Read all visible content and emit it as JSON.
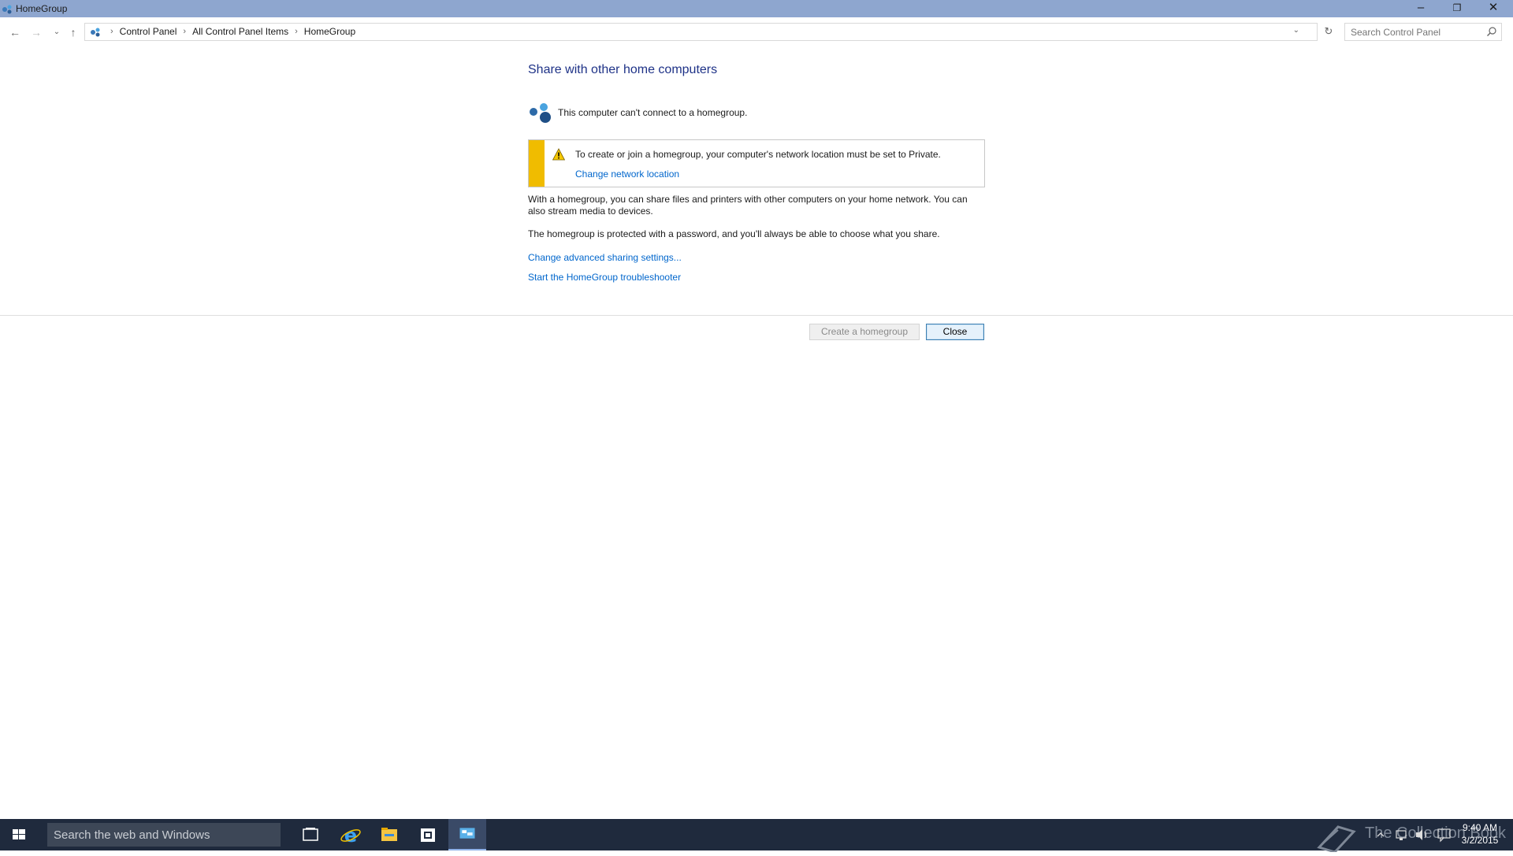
{
  "window": {
    "title": "HomeGroup",
    "controls": [
      "minimize",
      "restore",
      "close"
    ]
  },
  "nav": {
    "back_icon": "back-arrow-icon",
    "forward_icon": "forward-arrow-icon",
    "recent_icon": "chevron-down-icon",
    "up_icon": "up-arrow-icon"
  },
  "address": {
    "breadcrumbs": [
      "Control Panel",
      "All Control Panel Items",
      "HomeGroup"
    ]
  },
  "search": {
    "placeholder": "Search Control Panel"
  },
  "main": {
    "heading": "Share with other home computers",
    "status": "This computer can't connect to a homegroup.",
    "warning": {
      "text": "To create or join a homegroup, your computer's network location must be set to Private.",
      "link": "Change network location",
      "accent": "#f0bc00"
    },
    "para1": "With a homegroup, you can share files and printers with other computers on your home network. You can also stream media to devices.",
    "para2": "The homegroup is protected with a password, and you'll always be able to choose what you share.",
    "link_advanced": "Change advanced sharing settings...",
    "link_troubleshooter": "Start the HomeGroup troubleshooter"
  },
  "buttons": {
    "create": "Create a homegroup",
    "close": "Close"
  },
  "taskbar": {
    "search_placeholder": "Search the web and Windows",
    "watermark": "The Collection Book",
    "time": "9:40 AM",
    "date": "3/2/2015",
    "colors": {
      "bar": "#1f2a3d",
      "link": "#0066cc",
      "heading": "#1e3287"
    }
  }
}
